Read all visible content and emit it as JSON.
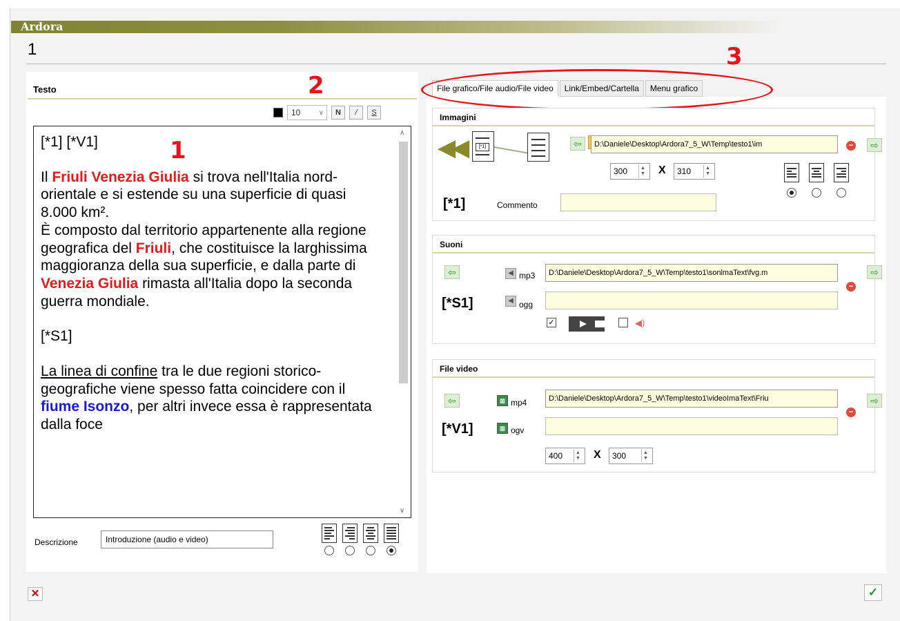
{
  "app": {
    "name": "Ardora",
    "window_title": "1"
  },
  "annotations": {
    "a1": "1",
    "a2": "2",
    "a3": "3"
  },
  "left": {
    "section_title": "Testo",
    "toolbar": {
      "font_size": "10",
      "bold": "N",
      "italic": "/",
      "strike": "S"
    },
    "editor": {
      "line1": "[*1]  [*V1]",
      "p1_a": "Il ",
      "p1_red1": "Friuli Venezia Giulia",
      "p1_b": " si trova nell'Italia nord-orientale e si estende su una superficie di quasi 8.000 km².",
      "p2_a": "È composto dal territorio appartenente alla regione geografica del ",
      "p2_red": "Friuli",
      "p2_b": ", che costituisce la larghissima maggioranza della sua superficie, e dalla parte di ",
      "p2_red2": "Venezia Giulia",
      "p2_c": " rimasta all'Italia dopo la seconda guerra mondiale.",
      "p3": "[*S1]",
      "p4_u": "La linea di confine",
      "p4_a": " tra le due regioni storico-geografiche viene spesso fatta coincidere con il ",
      "p4_blue": "fiume Isonzo",
      "p4_b": ", per altri invece essa è rappresentata dalla foce"
    },
    "description_label": "Descrizione",
    "description_value": "Introduzione (audio e video)"
  },
  "tabs": [
    "File grafico/File audio/File video",
    "Link/Embed/Cartella",
    "Menu grafico"
  ],
  "images": {
    "title": "Immagini",
    "path": "D:\\Daniele\\Desktop\\Ardora7_5_W\\Temp\\testo1\\im",
    "width": "300",
    "x": "X",
    "height": "310",
    "tag": "[*1]",
    "comment_label": "Commento",
    "doc_tag": "[*1]"
  },
  "sounds": {
    "title": "Suoni",
    "mp3_label": "mp3",
    "ogg_label": "ogg",
    "mp3_path": "D:\\Daniele\\Desktop\\Ardora7_5_W\\Temp\\testo1\\sonlmaText\\fvg.m",
    "tag": "[*S1]"
  },
  "video": {
    "title": "File video",
    "mp4_label": "mp4",
    "ogv_label": "ogv",
    "mp4_path": "D:\\Daniele\\Desktop\\Ardora7_5_W\\Temp\\testo1\\videoImaText\\Friu",
    "tag": "[*V1]",
    "width": "400",
    "x": "X",
    "height": "300"
  },
  "colors": {
    "accent_red": "#e8131b",
    "olive": "#808431",
    "input_bg": "#fffde0"
  }
}
